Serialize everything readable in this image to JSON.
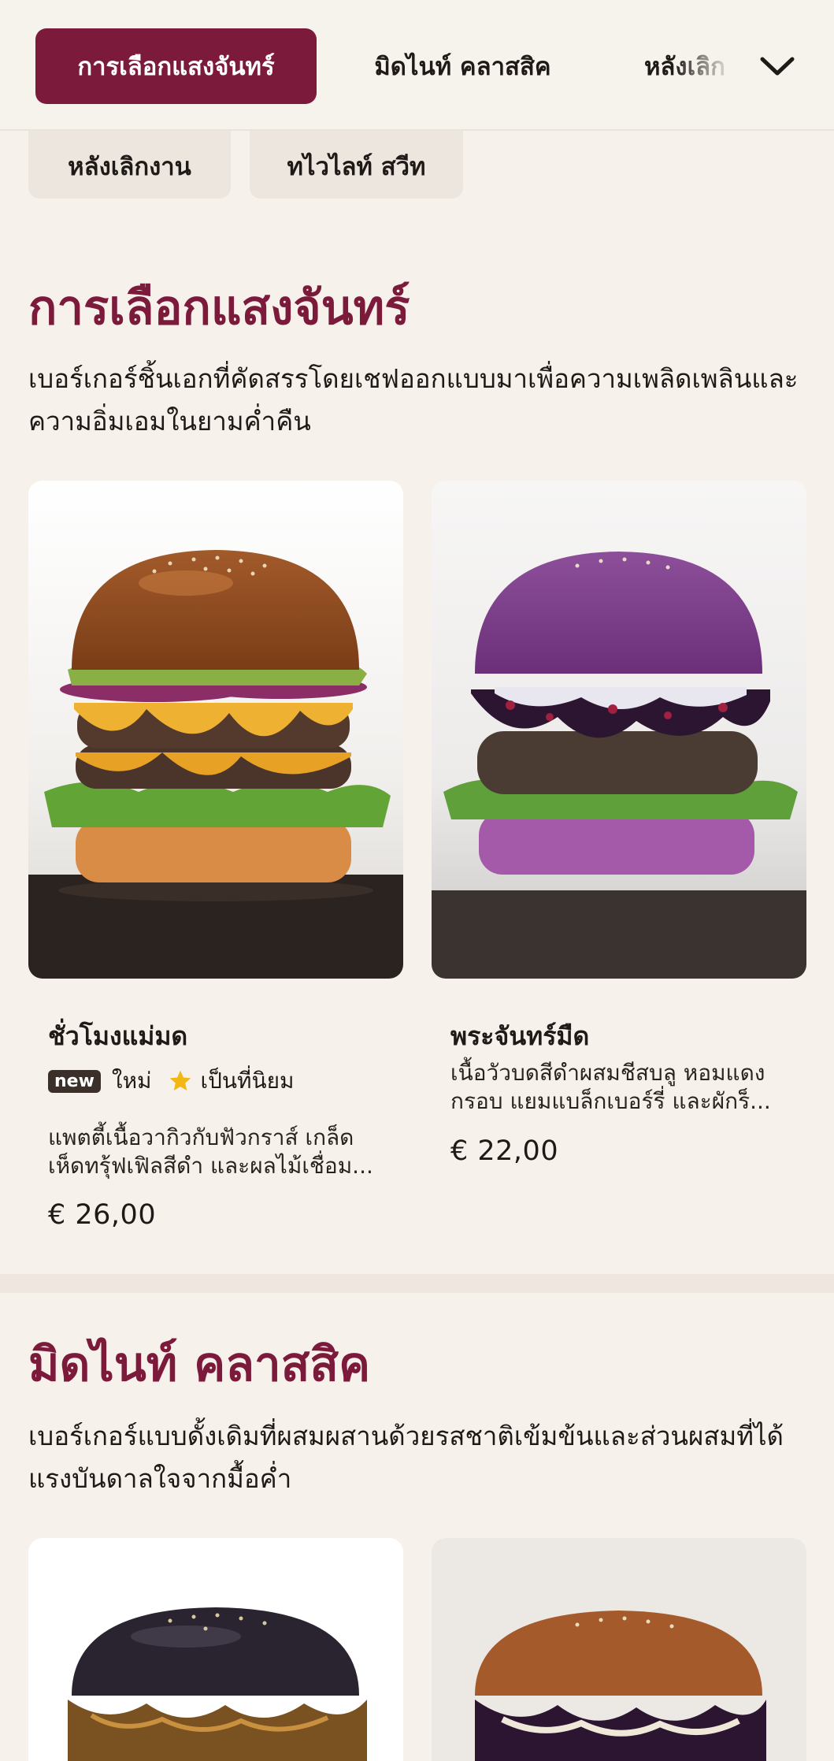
{
  "nav": {
    "tabs": [
      {
        "label": "การเลือกแสงจันทร์"
      },
      {
        "label": "มิดไนท์ คลาสสิค"
      },
      {
        "label": "หลังเลิก"
      }
    ],
    "chips": [
      {
        "label": "หลังเลิกงาน"
      },
      {
        "label": "ทไวไลท์ สวีท"
      }
    ]
  },
  "sections": [
    {
      "title": "การเลือกแสงจันทร์",
      "description": "เบอร์เกอร์ชิ้นเอกที่คัดสรรโดยเชฟออกแบบมาเพื่อความเพลิดเพลินและความอิ่มเอมในยามค่ำคืน",
      "items": [
        {
          "name": "ชั่วโมงแม่มด",
          "badge_new": "new",
          "badge_new_label": "ใหม่",
          "badge_popular_label": "เป็นที่นิยม",
          "description": "แพตตี้เนื้อวากิวกับฟัวกราส์ เกล็ดเห็ดทรุ้ฟเฟิลสีดำ และผลไม้เชื่อม...",
          "price": "€ 26,00"
        },
        {
          "name": "พระจันทร์มืด",
          "description": "เนื้อวัวบดสีดำผสมชีสบลู หอมแดงกรอบ แยมแบล็กเบอร์รี่ และผักร็...",
          "price": "€ 22,00"
        }
      ]
    },
    {
      "title": "มิดไนท์ คลาสสิค",
      "description": "เบอร์เกอร์แบบดั้งเดิมที่ผสมผสานด้วยรสชาติเข้มข้นและส่วนผสมที่ได้แรงบันดาลใจจากมื้อค่ำ"
    }
  ],
  "colors": {
    "accent": "#7c1a3c",
    "background": "#f6f1ea",
    "chip": "#ede6df",
    "star": "#f2b713"
  },
  "icons": {
    "dropdown": "chevron-down-icon",
    "popular": "star-icon"
  }
}
